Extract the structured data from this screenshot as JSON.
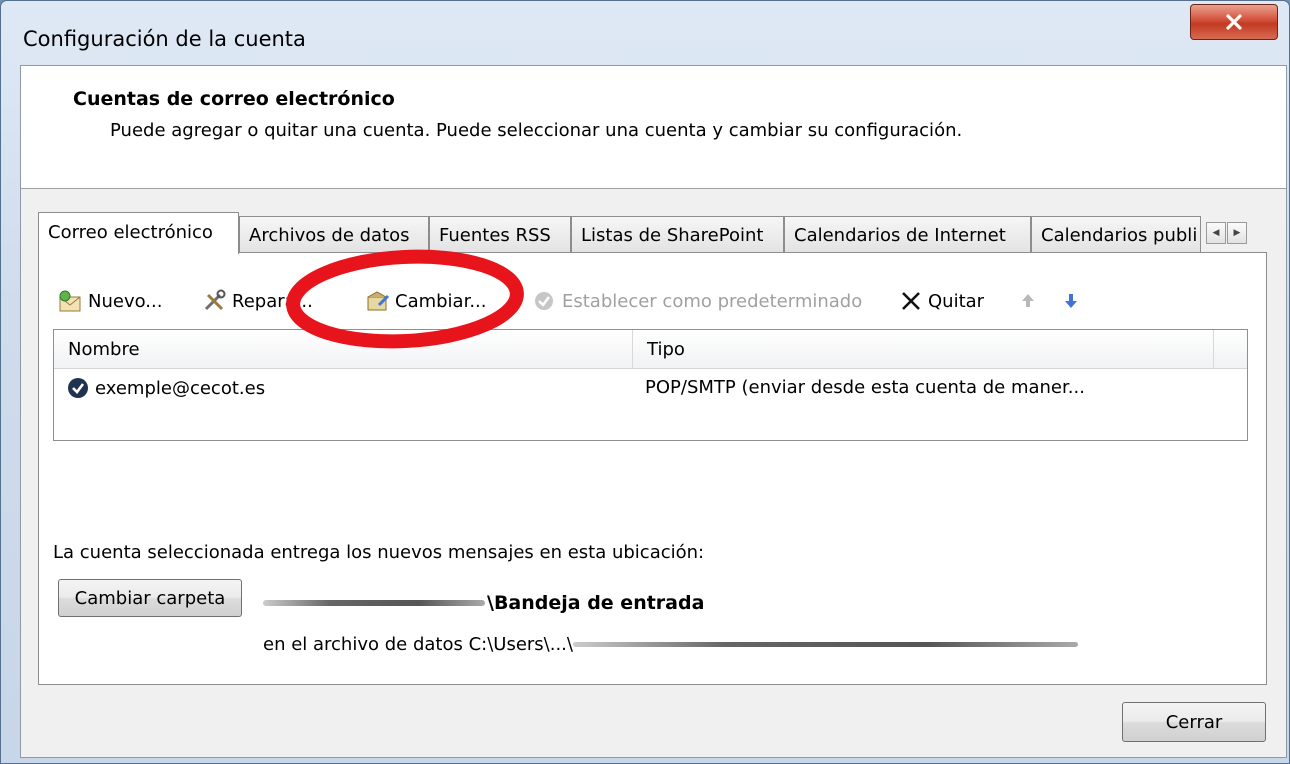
{
  "window": {
    "title": "Configuración de la cuenta"
  },
  "header": {
    "title": "Cuentas de correo electrónico",
    "subtitle": "Puede agregar o quitar una cuenta. Puede seleccionar una cuenta y cambiar su configuración."
  },
  "tabs": [
    {
      "label": "Correo electrónico",
      "active": true
    },
    {
      "label": "Archivos de datos"
    },
    {
      "label": "Fuentes RSS"
    },
    {
      "label": "Listas de SharePoint"
    },
    {
      "label": "Calendarios de Internet"
    },
    {
      "label": "Calendarios publi"
    }
  ],
  "toolbar": {
    "new_label": "Nuevo...",
    "repair_label": "Repara...",
    "change_label": "Cambiar...",
    "set_default_label": "Establecer como predeterminado",
    "remove_label": "Quitar"
  },
  "accounts_list": {
    "columns": [
      "Nombre",
      "Tipo"
    ],
    "rows": [
      {
        "name": "exemple@cecot.es",
        "type": "POP/SMTP (enviar desde esta cuenta de maner..."
      }
    ]
  },
  "delivery": {
    "label": "La cuenta seleccionada entrega los nuevos mensajes en esta ubicación:",
    "change_folder_label": "Cambiar carpeta",
    "folder": "\\Bandeja de entrada",
    "data_file": "en el archivo de datos C:\\Users\\...\\"
  },
  "footer": {
    "close_label": "Cerrar"
  },
  "colors": {
    "annotation": "#e8141c",
    "close_button": "#c8442c"
  }
}
